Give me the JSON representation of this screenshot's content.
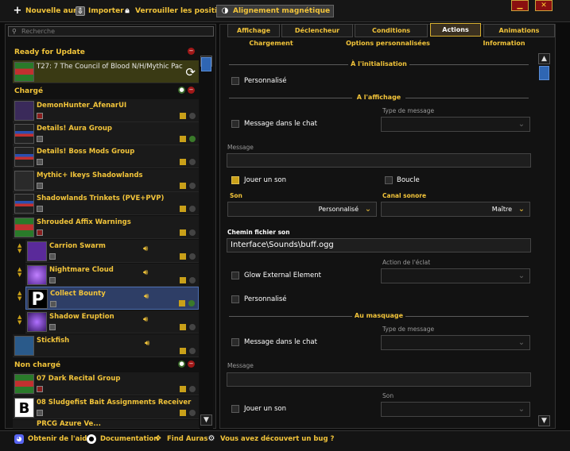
{
  "toolbar": {
    "new_aura": "Nouvelle aura",
    "import": "Importer",
    "lock": "Verrouiller les positions",
    "magnetic": "Alignement magnétique"
  },
  "search": {
    "placeholder": "Recherche"
  },
  "sections": {
    "ready": "Ready for Update",
    "loaded": "Chargé",
    "not_loaded": "Non chargé"
  },
  "auras": {
    "top": "T27: 7 The Council of Blood N/H/Mythic Pac",
    "loaded": [
      "DemonHunter_AfenarUI",
      "Details! Aura Group",
      "Details! Boss Mods Group",
      "Mythic+ Ikeys Shadowlands",
      "Shadowlands Trinkets (PVE+PVP)",
      "Shrouded Affix Warnings"
    ],
    "children": [
      "Carrion Swarm",
      "Nightmare Cloud",
      "Collect Bounty",
      "Shadow Eruption"
    ],
    "after": "Stickfish",
    "not_loaded": [
      "07 Dark Recital Group",
      "08 Sludgefist Bait Assignments Receiver",
      "PRCG Azure Ve..."
    ]
  },
  "tabs": {
    "row1": [
      "Affichage",
      "Déclencheur",
      "Conditions",
      "Actions",
      "Animations"
    ],
    "row2": [
      "Chargement",
      "Options personnalisées",
      "Information"
    ],
    "active": "Actions"
  },
  "actions": {
    "init_header": "À l'initialisation",
    "init_custom": "Personnalisé",
    "show_header": "A l'affichage",
    "msg_chat": "Message dans le chat",
    "msg_type_label": "Type de message",
    "message_label": "Message",
    "play_sound": "Jouer un son",
    "loop": "Boucle",
    "sound_label": "Son",
    "sound_value": "Personnalisé",
    "channel_label": "Canal sonore",
    "channel_value": "Maître",
    "sound_file_label": "Chemin fichier son",
    "sound_file_value": "Interface\\Sounds\\buff.ogg",
    "glow_action_label": "Action de l'éclat",
    "glow": "Glow External Element",
    "custom": "Personnalisé",
    "hide_header": "Au masquage",
    "hide_msg_chat": "Message dans le chat",
    "hide_msg_type_label": "Type de message",
    "hide_message_label": "Message",
    "hide_sound_label": "Son",
    "hide_play_sound": "Jouer un son"
  },
  "bottombar": {
    "help": "Obtenir de l'aide",
    "docs": "Documentation",
    "find": "Find Auras",
    "bug": "Vous avez découvert un bug ?"
  },
  "colors": {
    "accent": "#f2c43a",
    "selection": "#2e3e66",
    "scroll": "#2f66b3"
  }
}
